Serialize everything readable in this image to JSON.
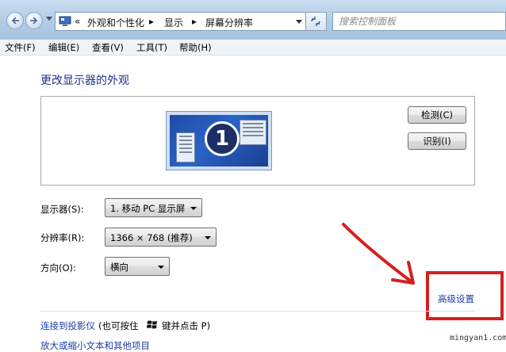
{
  "address_bar": {
    "overflow_chevron": "«",
    "breadcrumb": [
      "外观和个性化",
      "显示",
      "屏幕分辨率"
    ],
    "separator": "▸"
  },
  "search": {
    "placeholder": "搜索控制面板"
  },
  "menu": [
    "文件(F)",
    "编辑(E)",
    "查看(V)",
    "工具(T)",
    "帮助(H)"
  ],
  "page_title": "更改显示器的外观",
  "monitor_preview": {
    "number": "1"
  },
  "buttons": {
    "detect": "检测(C)",
    "identify": "识别(I)"
  },
  "fields": {
    "display": {
      "label": "显示器(S):",
      "value": "1. 移动 PC 显示屏"
    },
    "resolution": {
      "label": "分辨率(R):",
      "value": "1366 × 768 (推荐)"
    },
    "orientation": {
      "label": "方向(O):",
      "value": "横向"
    }
  },
  "advanced_link": "高级设置",
  "projector": {
    "link": "连接到投影仪",
    "hint_before": "(也可按住",
    "hint_after": "键并点击 P)"
  },
  "bottom_link_partial": "放大或缩小文本和其他项目",
  "watermark": "mingyan1.com",
  "colors": {
    "annotation_red": "#d42020",
    "link_blue": "#1e3ca0",
    "title_blue": "#1e3287"
  },
  "icons": [
    "back-arrow-icon",
    "forward-arrow-icon",
    "control-panel-icon",
    "refresh-icon",
    "windows-logo-icon",
    "red-annotation-arrow"
  ]
}
